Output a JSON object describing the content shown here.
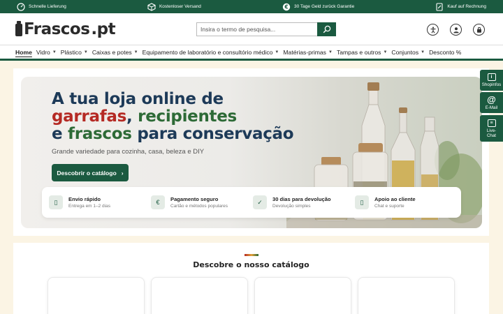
{
  "topbar": {
    "items": [
      {
        "label": "Schnelle Lieferung",
        "icon": "speedometer-icon"
      },
      {
        "label": "Kostenloser Versand",
        "icon": "package-icon"
      },
      {
        "label": "30 Tage Geld zurück Garantie",
        "icon": "euro-icon"
      },
      {
        "label": "Kauf auf Rechnung",
        "icon": "invoice-icon"
      }
    ]
  },
  "header": {
    "logo_text": "Frascos",
    "logo_tld": ".pt",
    "search_placeholder": "Insira o termo de pesquisa...",
    "icons": [
      "accessibility-icon",
      "account-icon",
      "cart-icon"
    ]
  },
  "nav": {
    "items": [
      {
        "label": "Home",
        "dropdown": false,
        "active": true
      },
      {
        "label": "Vidro",
        "dropdown": true
      },
      {
        "label": "Plástico",
        "dropdown": true
      },
      {
        "label": "Caixas e potes",
        "dropdown": true
      },
      {
        "label": "Equipamento de laboratório e consultório médico",
        "dropdown": true
      },
      {
        "label": "Matérias-primas",
        "dropdown": true
      },
      {
        "label": "Tampas e outros",
        "dropdown": true
      },
      {
        "label": "Conjuntos",
        "dropdown": true
      },
      {
        "label": "Desconto %",
        "dropdown": false
      }
    ]
  },
  "hero": {
    "line1": "A tua loja online de",
    "line2_red": "garrafas",
    "line2_sep": ", ",
    "line2_green": "recipientes",
    "line3_pre": "e ",
    "line3_green": "frascos",
    "line3_post": " para conservação",
    "subtitle": "Grande variedade para cozinha, casa, beleza e DIY",
    "cta": "Descobrir o catálogo",
    "cta_chevron": "›"
  },
  "features": [
    {
      "title": "Envio rápido",
      "desc": "Entrega em 1–2 dias",
      "icon": "truck-icon",
      "glyph": "▯"
    },
    {
      "title": "Pagamento seguro",
      "desc": "Cartão e métodos populares",
      "icon": "euro-icon",
      "glyph": "€"
    },
    {
      "title": "30 dias para devolução",
      "desc": "Devolução simples",
      "icon": "check-icon",
      "glyph": "✓"
    },
    {
      "title": "Apoio ao cliente",
      "desc": "Chat e suporte",
      "icon": "support-icon",
      "glyph": "▯"
    }
  ],
  "sidebar": {
    "shopinfos": "Shopinfos",
    "email": "E-Mail",
    "livechat_1": "Live-",
    "livechat_2": "Chat"
  },
  "catalog": {
    "title": "Descobre o nosso catálogo",
    "card_count": 4
  },
  "colors": {
    "brand_green": "#1b5a40",
    "title_navy": "#1d3a58",
    "accent_red": "#b52a24",
    "accent_green": "#2d6a36"
  }
}
